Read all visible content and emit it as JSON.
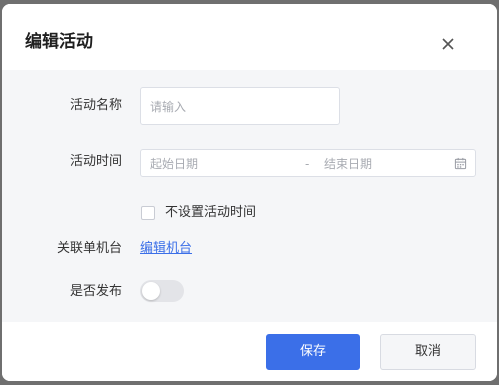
{
  "dialog": {
    "title": "编辑活动",
    "close_icon": "close-icon"
  },
  "form": {
    "name_label": "活动名称",
    "name_placeholder": "请输入",
    "time_label": "活动时间",
    "start_placeholder": "起始日期",
    "range_separator": "-",
    "end_placeholder": "结束日期",
    "calendar_icon": "calendar-icon",
    "no_time_label": "不设置活动时间",
    "no_time_checked": false,
    "device_label": "关联单机台",
    "device_link": "编辑机台",
    "publish_label": "是否发布",
    "publish_on": false
  },
  "footer": {
    "save_label": "保存",
    "cancel_label": "取消"
  },
  "colors": {
    "primary": "#3b6fe8",
    "body_bg": "#f5f6f8"
  }
}
